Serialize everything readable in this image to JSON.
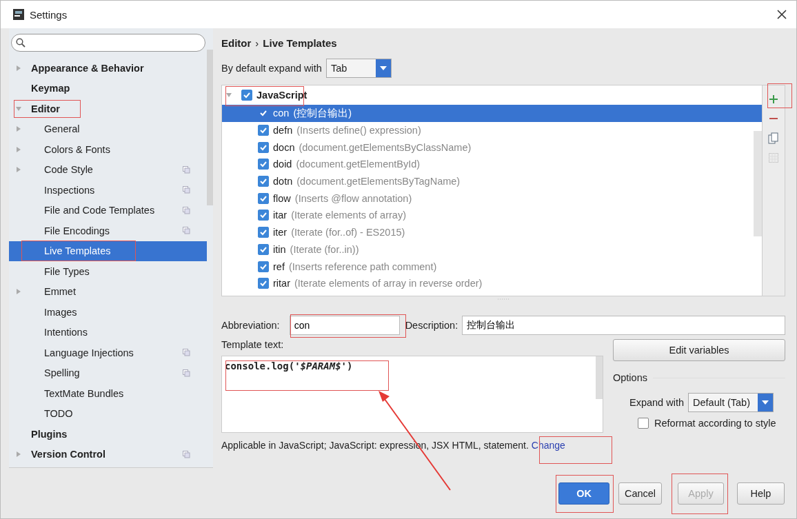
{
  "window": {
    "title": "Settings"
  },
  "sidebar": {
    "items": [
      {
        "label": "Appearance & Behavior",
        "bold": true,
        "expanded": false,
        "selected": false,
        "project_icon": false
      },
      {
        "label": "Keymap",
        "bold": true,
        "selected": false,
        "project_icon": false
      },
      {
        "label": "Editor",
        "bold": true,
        "expanded": true,
        "selected": false,
        "project_icon": false,
        "children": [
          {
            "label": "General",
            "expanded": false,
            "selected": false,
            "project_icon": false
          },
          {
            "label": "Colors & Fonts",
            "expanded": false,
            "selected": false,
            "project_icon": false
          },
          {
            "label": "Code Style",
            "expanded": false,
            "selected": false,
            "project_icon": true
          },
          {
            "label": "Inspections",
            "selected": false,
            "project_icon": true
          },
          {
            "label": "File and Code Templates",
            "selected": false,
            "project_icon": true
          },
          {
            "label": "File Encodings",
            "selected": false,
            "project_icon": true
          },
          {
            "label": "Live Templates",
            "selected": true,
            "project_icon": false
          },
          {
            "label": "File Types",
            "selected": false,
            "project_icon": false
          },
          {
            "label": "Emmet",
            "expanded": false,
            "selected": false,
            "project_icon": false
          },
          {
            "label": "Images",
            "selected": false,
            "project_icon": false
          },
          {
            "label": "Intentions",
            "selected": false,
            "project_icon": false
          },
          {
            "label": "Language Injections",
            "selected": false,
            "project_icon": true
          },
          {
            "label": "Spelling",
            "selected": false,
            "project_icon": true
          },
          {
            "label": "TextMate Bundles",
            "selected": false,
            "project_icon": false
          },
          {
            "label": "TODO",
            "selected": false,
            "project_icon": false
          }
        ]
      },
      {
        "label": "Plugins",
        "bold": true,
        "selected": false,
        "project_icon": false
      },
      {
        "label": "Version Control",
        "bold": true,
        "expanded": false,
        "selected": false,
        "project_icon": true
      }
    ]
  },
  "breadcrumb": [
    "Editor",
    "›",
    "Live Templates"
  ],
  "expand_default": {
    "label": "By default expand with",
    "value": "Tab"
  },
  "templates": {
    "group": {
      "name": "JavaScript",
      "checked": true,
      "expanded": true
    },
    "items": [
      {
        "abbreviation": "con",
        "description": "(控制台输出)",
        "checked": true,
        "selected": true
      },
      {
        "abbreviation": "defn",
        "description": "(Inserts define() expression)",
        "checked": true,
        "selected": false
      },
      {
        "abbreviation": "docn",
        "description": "(document.getElementsByClassName)",
        "checked": true,
        "selected": false
      },
      {
        "abbreviation": "doid",
        "description": "(document.getElementById)",
        "checked": true,
        "selected": false
      },
      {
        "abbreviation": "dotn",
        "description": "(document.getElementsByTagName)",
        "checked": true,
        "selected": false
      },
      {
        "abbreviation": "flow",
        "description": "(Inserts @flow annotation)",
        "checked": true,
        "selected": false
      },
      {
        "abbreviation": "itar",
        "description": "(Iterate elements of array)",
        "checked": true,
        "selected": false
      },
      {
        "abbreviation": "iter",
        "description": "(Iterate (for..of) - ES2015)",
        "checked": true,
        "selected": false
      },
      {
        "abbreviation": "itin",
        "description": "(Iterate (for..in))",
        "checked": true,
        "selected": false
      },
      {
        "abbreviation": "ref",
        "description": "(Inserts reference path comment)",
        "checked": true,
        "selected": false
      },
      {
        "abbreviation": "ritar",
        "description": "(Iterate elements of array in reverse order)",
        "checked": true,
        "selected": false
      }
    ]
  },
  "abbreviation": {
    "label": "Abbreviation:",
    "value": "con"
  },
  "description": {
    "label": "Description:",
    "value": "控制台输出"
  },
  "template_text": {
    "label": "Template text:",
    "value": "console.log('*$PARAM$*')"
  },
  "edit_variables": "Edit variables",
  "options": {
    "title": "Options",
    "expand_label": "Expand with",
    "expand_value": "Default (Tab)",
    "reformat_label": "Reformat according to style",
    "reformat_checked": false
  },
  "applicable": {
    "text": "Applicable in JavaScript; JavaScript: expression, JSX HTML, statement.",
    "link": "Change"
  },
  "buttons": [
    {
      "label": "OK",
      "kind": "primary",
      "disabled": false
    },
    {
      "label": "Cancel",
      "kind": "normal",
      "disabled": false
    },
    {
      "label": "Apply",
      "kind": "normal",
      "disabled": true
    },
    {
      "label": "Help",
      "kind": "normal",
      "disabled": false
    }
  ]
}
